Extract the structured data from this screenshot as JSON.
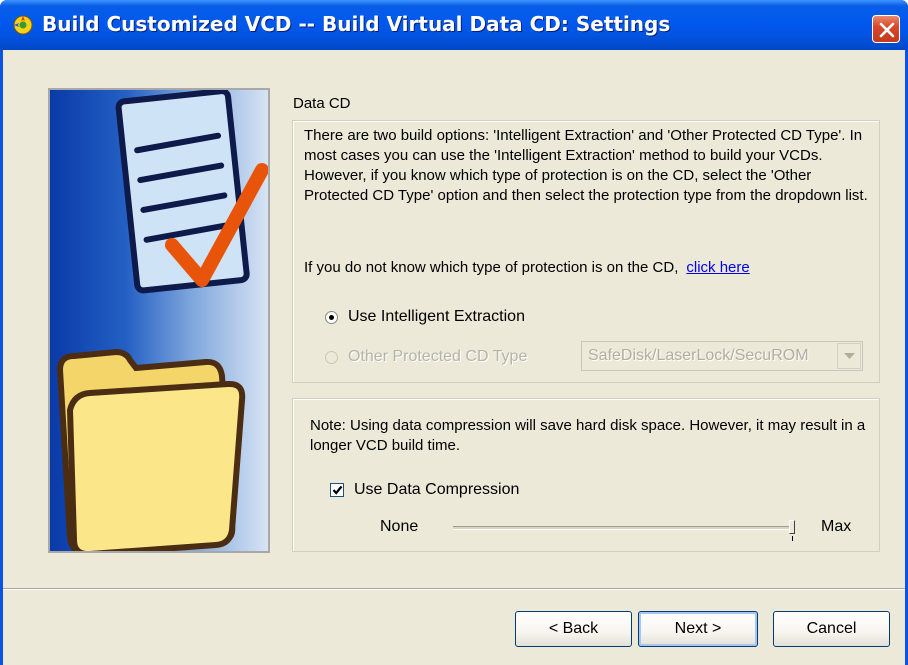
{
  "window": {
    "title": "Build Customized VCD  --  Build Virtual Data CD: Settings"
  },
  "data_cd": {
    "section_label": "Data CD",
    "description": "There are two build options: 'Intelligent Extraction' and 'Other Protected CD Type'. In most cases you can use the 'Intelligent Extraction' method to build your VCDs. However, if you know which type of protection is on the CD, select the 'Other Protected CD Type' option and then select the protection type from the dropdown list.",
    "help_text": "If you do not know which type of protection is on the CD,",
    "help_link": "click here",
    "option_intelligent": "Use Intelligent Extraction",
    "option_other": "Other Protected CD Type",
    "protection_type": "SafeDisk/LaserLock/SecuROM",
    "selected_option": "Use Intelligent Extraction"
  },
  "compression": {
    "note": "Note: Using data compression will save hard disk space. However, it may result in a longer VCD build time.",
    "checkbox_label": "Use Data Compression",
    "checked": true,
    "min_label": "None",
    "max_label": "Max",
    "level": 1.0
  },
  "buttons": {
    "back": "< Back",
    "next": "Next >",
    "cancel": "Cancel"
  },
  "colors": {
    "titlebar": "#0058ee",
    "client_bg": "#ece9d8",
    "close_button": "#d8492a",
    "link": "#0000ee"
  }
}
